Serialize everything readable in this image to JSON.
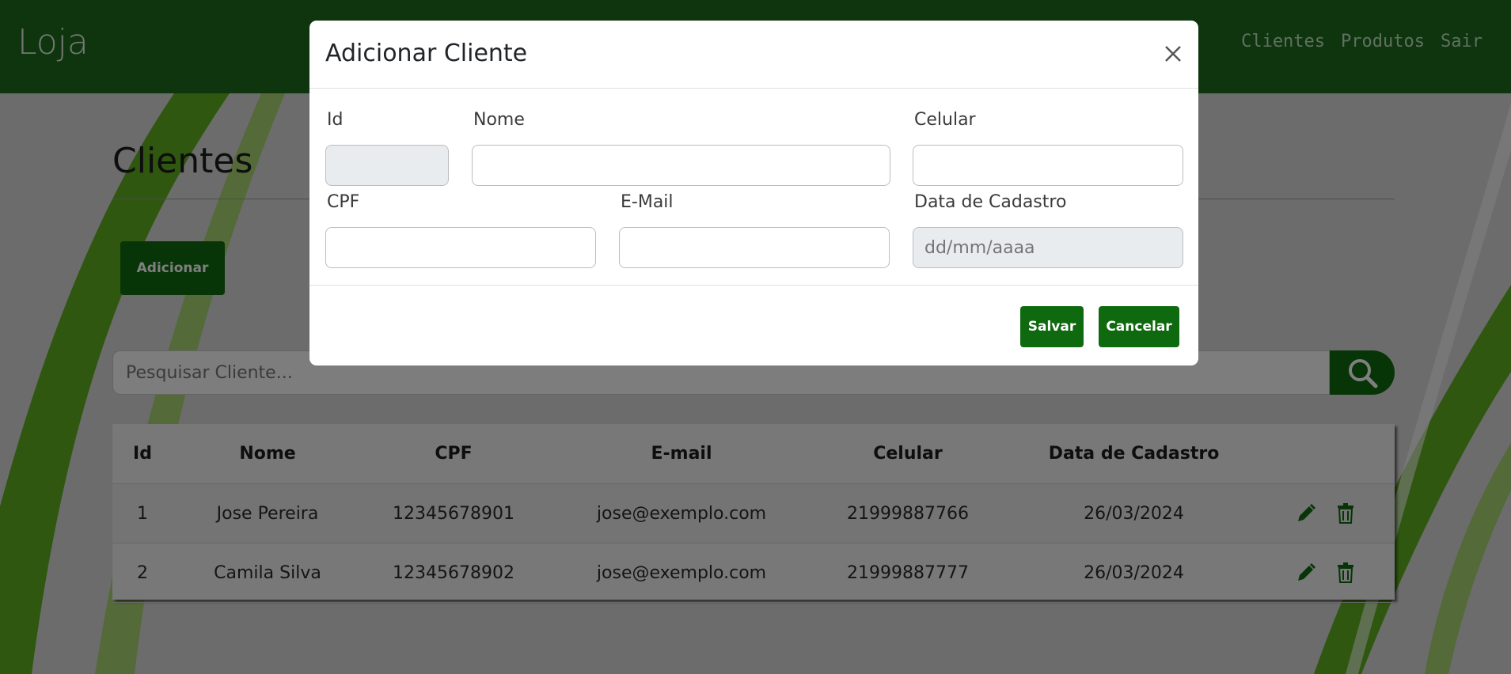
{
  "navbar": {
    "brand": "Loja",
    "links": [
      "Clientes",
      "Produtos",
      "Sair"
    ]
  },
  "page": {
    "title": "Clientes",
    "add_button": "Adicionar",
    "search_placeholder": "Pesquisar Cliente..."
  },
  "table": {
    "headers": [
      "Id",
      "Nome",
      "CPF",
      "E-mail",
      "Celular",
      "Data de Cadastro"
    ],
    "rows": [
      [
        "1",
        "Jose Pereira",
        "12345678901",
        "jose@exemplo.com",
        "21999887766",
        "26/03/2024"
      ],
      [
        "2",
        "Camila Silva",
        "12345678902",
        "jose@exemplo.com",
        "21999887777",
        "26/03/2024"
      ]
    ]
  },
  "modal": {
    "title": "Adicionar Cliente",
    "fields": {
      "id": {
        "label": "Id",
        "value": ""
      },
      "nome": {
        "label": "Nome",
        "value": ""
      },
      "celular": {
        "label": "Celular",
        "value": ""
      },
      "cpf": {
        "label": "CPF",
        "value": ""
      },
      "email": {
        "label": "E-Mail",
        "value": ""
      },
      "data": {
        "label": "Data de Cadastro",
        "placeholder": "dd/mm/aaaa"
      }
    },
    "save_button": "Salvar",
    "cancel_button": "Cancelar"
  },
  "colors": {
    "navbar": "#1c6a1c",
    "primary_button": "#0f6a0f",
    "icon_green": "#0f6a0f",
    "background_stripe": "#5fae1f"
  }
}
